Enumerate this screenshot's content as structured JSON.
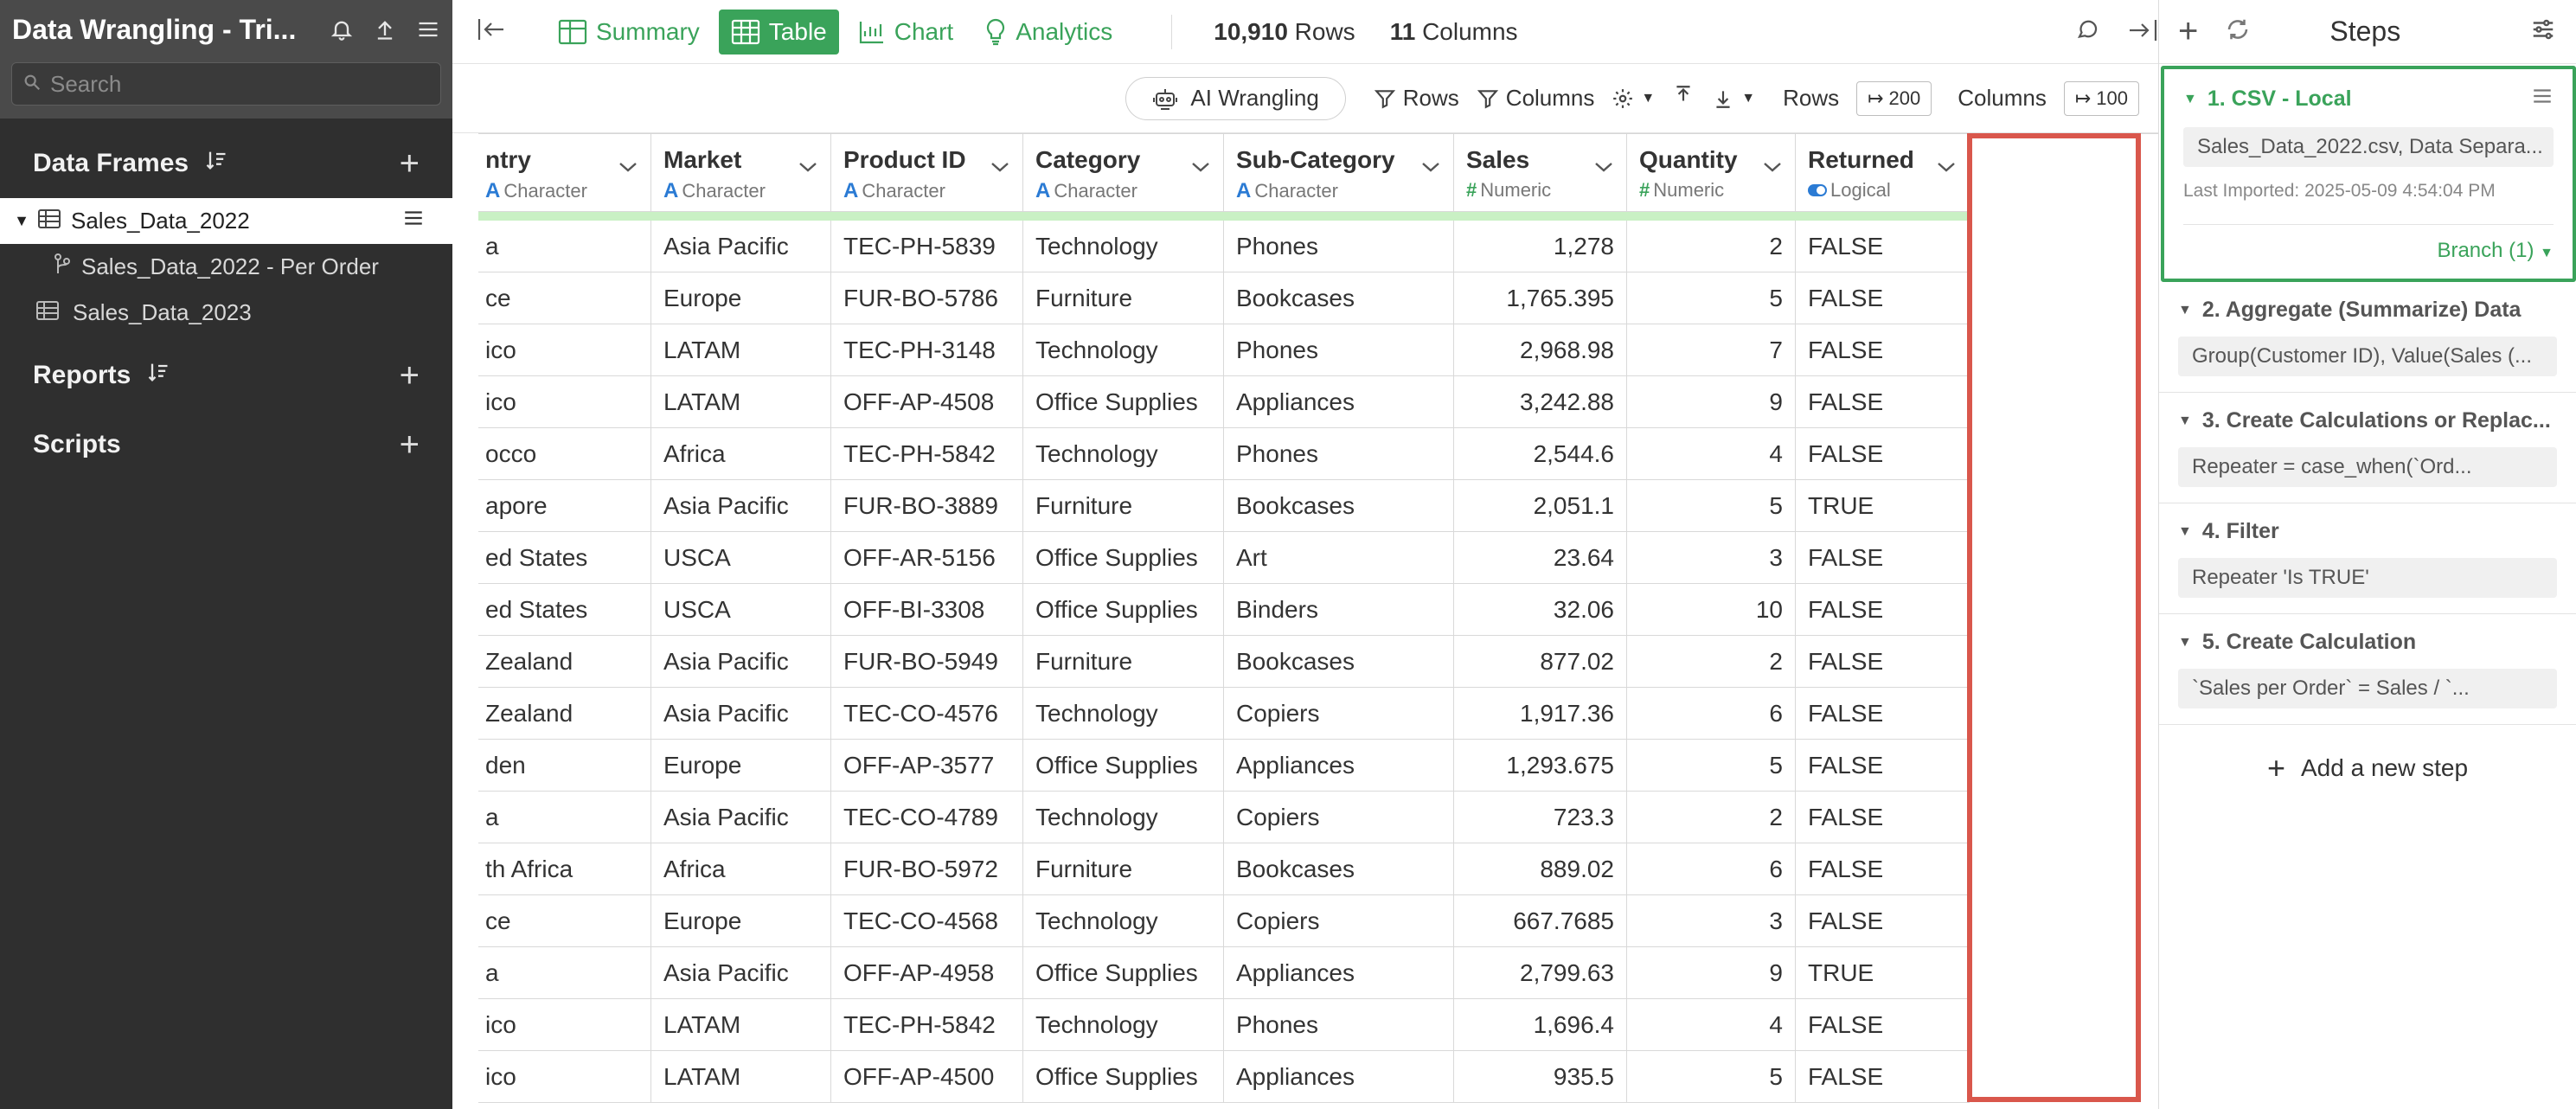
{
  "sidebar": {
    "title": "Data Wrangling - Tri...",
    "search_placeholder": "Search",
    "data_frames_label": "Data Frames",
    "frames": [
      {
        "label": "Sales_Data_2022"
      },
      {
        "label": "Sales_Data_2022 - Per Order"
      },
      {
        "label": "Sales_Data_2023"
      }
    ],
    "reports_label": "Reports",
    "scripts_label": "Scripts"
  },
  "toolbar": {
    "summary": "Summary",
    "table": "Table",
    "chart": "Chart",
    "analytics": "Analytics",
    "rows_count": "10,910",
    "rows_word": "Rows",
    "cols_count": "11",
    "cols_word": "Columns"
  },
  "subtoolbar": {
    "ai_wrangling": "AI Wrangling",
    "rows_filter": "Rows",
    "columns_filter": "Columns",
    "rows_label": "Rows",
    "rows_value": "200",
    "columns_label": "Columns",
    "columns_value": "100"
  },
  "table": {
    "columns": [
      {
        "name": "Country",
        "display": "ntry",
        "type": "Character"
      },
      {
        "name": "Market",
        "display": "Market",
        "type": "Character"
      },
      {
        "name": "Product ID",
        "display": "Product ID",
        "type": "Character"
      },
      {
        "name": "Category",
        "display": "Category",
        "type": "Character"
      },
      {
        "name": "Sub-Category",
        "display": "Sub-Category",
        "type": "Character"
      },
      {
        "name": "Sales",
        "display": "Sales",
        "type": "Numeric"
      },
      {
        "name": "Quantity",
        "display": "Quantity",
        "type": "Numeric"
      },
      {
        "name": "Returned",
        "display": "Returned",
        "type": "Logical"
      }
    ],
    "rows": [
      [
        "a",
        "Asia Pacific",
        "TEC-PH-5839",
        "Technology",
        "Phones",
        "1,278",
        "2",
        "FALSE"
      ],
      [
        "ce",
        "Europe",
        "FUR-BO-5786",
        "Furniture",
        "Bookcases",
        "1,765.395",
        "5",
        "FALSE"
      ],
      [
        "ico",
        "LATAM",
        "TEC-PH-3148",
        "Technology",
        "Phones",
        "2,968.98",
        "7",
        "FALSE"
      ],
      [
        "ico",
        "LATAM",
        "OFF-AP-4508",
        "Office Supplies",
        "Appliances",
        "3,242.88",
        "9",
        "FALSE"
      ],
      [
        "occo",
        "Africa",
        "TEC-PH-5842",
        "Technology",
        "Phones",
        "2,544.6",
        "4",
        "FALSE"
      ],
      [
        "apore",
        "Asia Pacific",
        "FUR-BO-3889",
        "Furniture",
        "Bookcases",
        "2,051.1",
        "5",
        "TRUE"
      ],
      [
        "ed States",
        "USCA",
        "OFF-AR-5156",
        "Office Supplies",
        "Art",
        "23.64",
        "3",
        "FALSE"
      ],
      [
        "ed States",
        "USCA",
        "OFF-BI-3308",
        "Office Supplies",
        "Binders",
        "32.06",
        "10",
        "FALSE"
      ],
      [
        " Zealand",
        "Asia Pacific",
        "FUR-BO-5949",
        "Furniture",
        "Bookcases",
        "877.02",
        "2",
        "FALSE"
      ],
      [
        " Zealand",
        "Asia Pacific",
        "TEC-CO-4576",
        "Technology",
        "Copiers",
        "1,917.36",
        "6",
        "FALSE"
      ],
      [
        "den",
        "Europe",
        "OFF-AP-3577",
        "Office Supplies",
        "Appliances",
        "1,293.675",
        "5",
        "FALSE"
      ],
      [
        "a",
        "Asia Pacific",
        "TEC-CO-4789",
        "Technology",
        "Copiers",
        "723.3",
        "2",
        "FALSE"
      ],
      [
        "th Africa",
        "Africa",
        "FUR-BO-5972",
        "Furniture",
        "Bookcases",
        "889.02",
        "6",
        "FALSE"
      ],
      [
        "ce",
        "Europe",
        "TEC-CO-4568",
        "Technology",
        "Copiers",
        "667.7685",
        "3",
        "FALSE"
      ],
      [
        "a",
        "Asia Pacific",
        "OFF-AP-4958",
        "Office Supplies",
        "Appliances",
        "2,799.63",
        "9",
        "TRUE"
      ],
      [
        "ico",
        "LATAM",
        "TEC-PH-5842",
        "Technology",
        "Phones",
        "1,696.4",
        "4",
        "FALSE"
      ],
      [
        "ico",
        "LATAM",
        "OFF-AP-4500",
        "Office Supplies",
        "Appliances",
        "935.5",
        "5",
        "FALSE"
      ]
    ]
  },
  "steps": {
    "title": "Steps",
    "items": [
      {
        "title": "1. CSV - Local",
        "body": "Sales_Data_2022.csv, Data Separa...",
        "meta": "Last Imported: 2025-05-09 4:54:04 PM",
        "branch": "Branch (1)"
      },
      {
        "title": "2. Aggregate (Summarize) Data",
        "body": "Group(Customer ID), Value(Sales (..."
      },
      {
        "title": "3. Create Calculations or Replac...",
        "body": "Repeater = case_when(`Ord..."
      },
      {
        "title": "4. Filter",
        "body": "Repeater 'Is TRUE'"
      },
      {
        "title": "5. Create Calculation",
        "body": "`Sales per Order` = Sales / `..."
      }
    ],
    "add_step": "Add a new step"
  },
  "colors": {
    "accent_green": "#3aa35a",
    "selection_red": "#d9574c",
    "sidebar_bg": "#2f2f2f"
  }
}
